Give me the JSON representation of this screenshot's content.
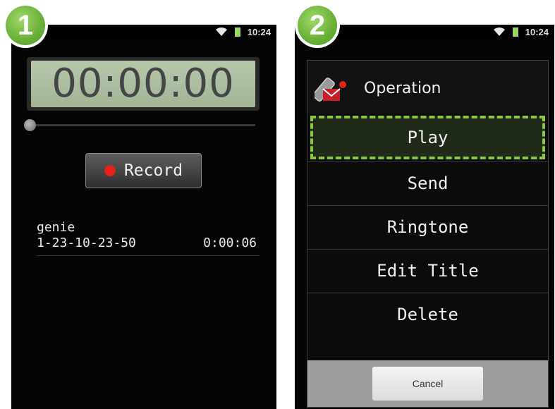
{
  "step_badges": [
    "1",
    "2"
  ],
  "status_bar": {
    "time": "10:24"
  },
  "panel1": {
    "timer": "00:00:00",
    "playback_progress": 0,
    "record_button": "Record",
    "recording": {
      "name": "genie",
      "date": "1-23-10-23-50",
      "duration": "0:00:06"
    }
  },
  "panel2": {
    "dialog_title": "Operation",
    "menu": [
      "Play",
      "Send",
      "Ringtone",
      "Edit Title",
      "Delete"
    ],
    "highlighted_item": "Play",
    "cancel_button": "Cancel"
  },
  "colors": {
    "badge_green": "#6cb33a",
    "highlight_dash": "#8dc63f",
    "record_red": "#e2231a"
  },
  "icons": [
    "wifi-icon",
    "battery-icon",
    "record-dot-icon",
    "operation-envelope-icon"
  ]
}
